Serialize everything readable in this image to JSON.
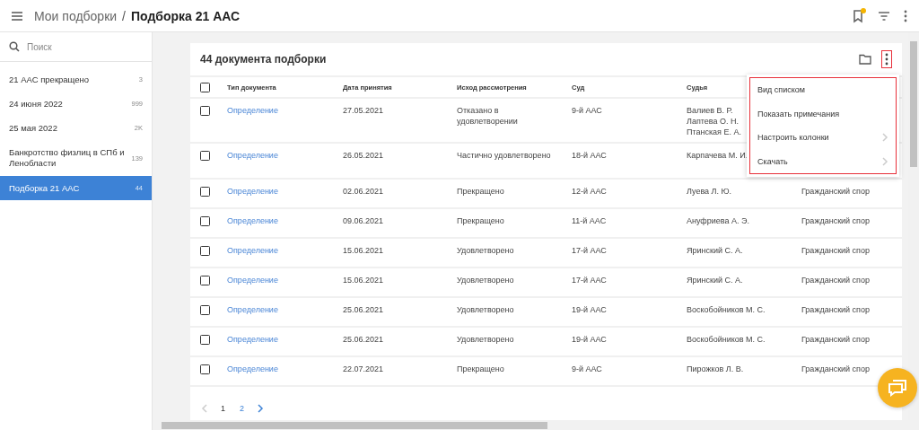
{
  "header": {
    "breadcrumb": [
      {
        "label": "Мои подборки",
        "current": false
      },
      {
        "label": "Подборка 21 ААС",
        "current": true
      }
    ],
    "separator": "/",
    "bookmark_badge": true
  },
  "sidebar": {
    "search": {
      "placeholder": "Поиск"
    },
    "items": [
      {
        "label": "21 ААС прекращено",
        "count": "3",
        "selected": false
      },
      {
        "label": "24 июня 2022",
        "count": "999",
        "selected": false
      },
      {
        "label": "25 мая 2022",
        "count": "2K",
        "selected": false
      },
      {
        "label": "Банкротство физлиц в СПб и Ленобласти",
        "count": "139",
        "selected": false
      },
      {
        "label": "Подборка 21 ААС",
        "count": "44",
        "selected": true
      }
    ]
  },
  "card": {
    "title": "44 документа подборки",
    "table": {
      "all_checked": false,
      "columns": [
        "Тип документа",
        "Дата принятия",
        "Исход рассмотрения",
        "Суд",
        "Судья"
      ],
      "rows": [
        {
          "checked": false,
          "type": "Определение",
          "date": "27.05.2021",
          "outcome": "Отказано в удовлетворении",
          "court": "9-й ААС",
          "judges": [
            "Валиев В. Р.",
            "Лаптева О. Н.",
            "Птанская Е. А."
          ]
        },
        {
          "checked": false,
          "type": "Определение",
          "date": "26.05.2021",
          "outcome": "Частично удовлетворено",
          "court": "18-й ААС",
          "judges": [
            "Карпачева М. И."
          ]
        },
        {
          "checked": false,
          "type": "Определение",
          "date": "02.06.2021",
          "outcome": "Прекращено",
          "court": "12-й ААС",
          "judges": [
            "Луева Л. Ю."
          ],
          "column_7": "Гражданский спор"
        },
        {
          "checked": false,
          "type": "Определение",
          "date": "09.06.2021",
          "outcome": "Прекращено",
          "court": "11-й ААС",
          "judges": [
            "Ануфриева А. Э."
          ],
          "column_7": "Гражданский спор"
        },
        {
          "checked": false,
          "type": "Определение",
          "date": "15.06.2021",
          "outcome": "Удовлетворено",
          "court": "17-й ААС",
          "judges": [
            "Яринский С. А."
          ],
          "column_7": "Гражданский спор"
        },
        {
          "checked": false,
          "type": "Определение",
          "date": "15.06.2021",
          "outcome": "Удовлетворено",
          "court": "17-й ААС",
          "judges": [
            "Яринский С. А."
          ],
          "column_7": "Гражданский спор"
        },
        {
          "checked": false,
          "type": "Определение",
          "date": "25.06.2021",
          "outcome": "Удовлетворено",
          "court": "19-й ААС",
          "judges": [
            "Воскобойников М. С."
          ],
          "column_7": "Гражданский спор"
        },
        {
          "checked": false,
          "type": "Определение",
          "date": "25.06.2021",
          "outcome": "Удовлетворено",
          "court": "19-й ААС",
          "judges": [
            "Воскобойников М. С."
          ],
          "column_7": "Гражданский спор"
        },
        {
          "checked": false,
          "type": "Определение",
          "date": "22.07.2021",
          "outcome": "Прекращено",
          "court": "9-й ААС",
          "judges": [
            "Пирожков Л. В."
          ],
          "column_7": "Гражданский спор"
        }
      ]
    },
    "pagination": {
      "pages": [
        {
          "label": "1",
          "selected": true
        },
        {
          "label": "2",
          "selected": false
        }
      ],
      "prev_disabled": true,
      "next_disabled": false
    }
  },
  "menu": {
    "items": [
      {
        "label": "Вид списком",
        "submenu": false
      },
      {
        "label": "Показать примечания",
        "submenu": false
      },
      {
        "label": "Настроить колонки",
        "submenu": true
      },
      {
        "label": "Скачать",
        "submenu": true
      }
    ]
  }
}
